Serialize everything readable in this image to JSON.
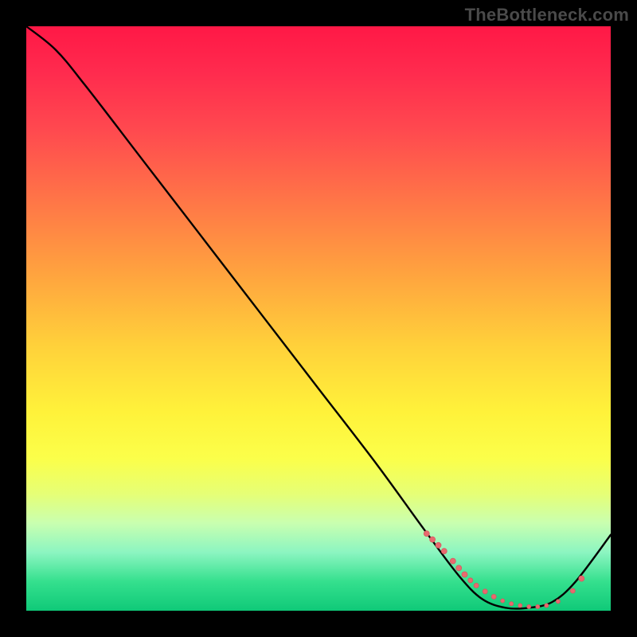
{
  "watermark": "TheBottleneck.com",
  "colors": {
    "page_bg": "#000000",
    "watermark": "#4a4a4a",
    "curve": "#000000",
    "marker_fill": "#e86a6f",
    "marker_stroke": "#d45a60",
    "gradient_stops": [
      "#ff1846",
      "#ff2b4e",
      "#ff4a4f",
      "#ff7647",
      "#ffa23f",
      "#ffd23a",
      "#fff23a",
      "#fbff4a",
      "#e6ff76",
      "#c9ffb0",
      "#8cf5c1",
      "#35e08e",
      "#0fc978"
    ]
  },
  "chart_data": {
    "type": "line",
    "title": "",
    "xlabel": "",
    "ylabel": "",
    "xlim": [
      0,
      100
    ],
    "ylim": [
      0,
      100
    ],
    "x": [
      0,
      5,
      10,
      20,
      30,
      40,
      50,
      60,
      68,
      74,
      78,
      82,
      86,
      90,
      94,
      100
    ],
    "values": [
      100,
      96,
      90,
      77,
      64,
      51,
      38,
      25,
      14,
      6,
      2,
      0.5,
      0.5,
      1.5,
      5,
      13
    ],
    "markers": {
      "x": [
        68.5,
        69.5,
        70.5,
        71.5,
        73,
        74,
        75,
        76,
        77,
        78.5,
        80,
        81.5,
        83,
        84.5,
        86,
        87.5,
        89,
        91,
        93.5,
        95
      ],
      "y": [
        13.2,
        12.2,
        11.2,
        10.2,
        8.5,
        7.3,
        6.2,
        5.2,
        4.3,
        3.3,
        2.4,
        1.7,
        1.2,
        0.9,
        0.7,
        0.7,
        0.9,
        1.6,
        3.4,
        5.5
      ],
      "size": [
        7,
        7,
        7,
        7,
        7,
        7,
        7,
        6,
        6,
        6,
        6,
        5,
        5,
        5,
        5,
        5,
        5,
        5,
        6,
        7
      ]
    }
  }
}
